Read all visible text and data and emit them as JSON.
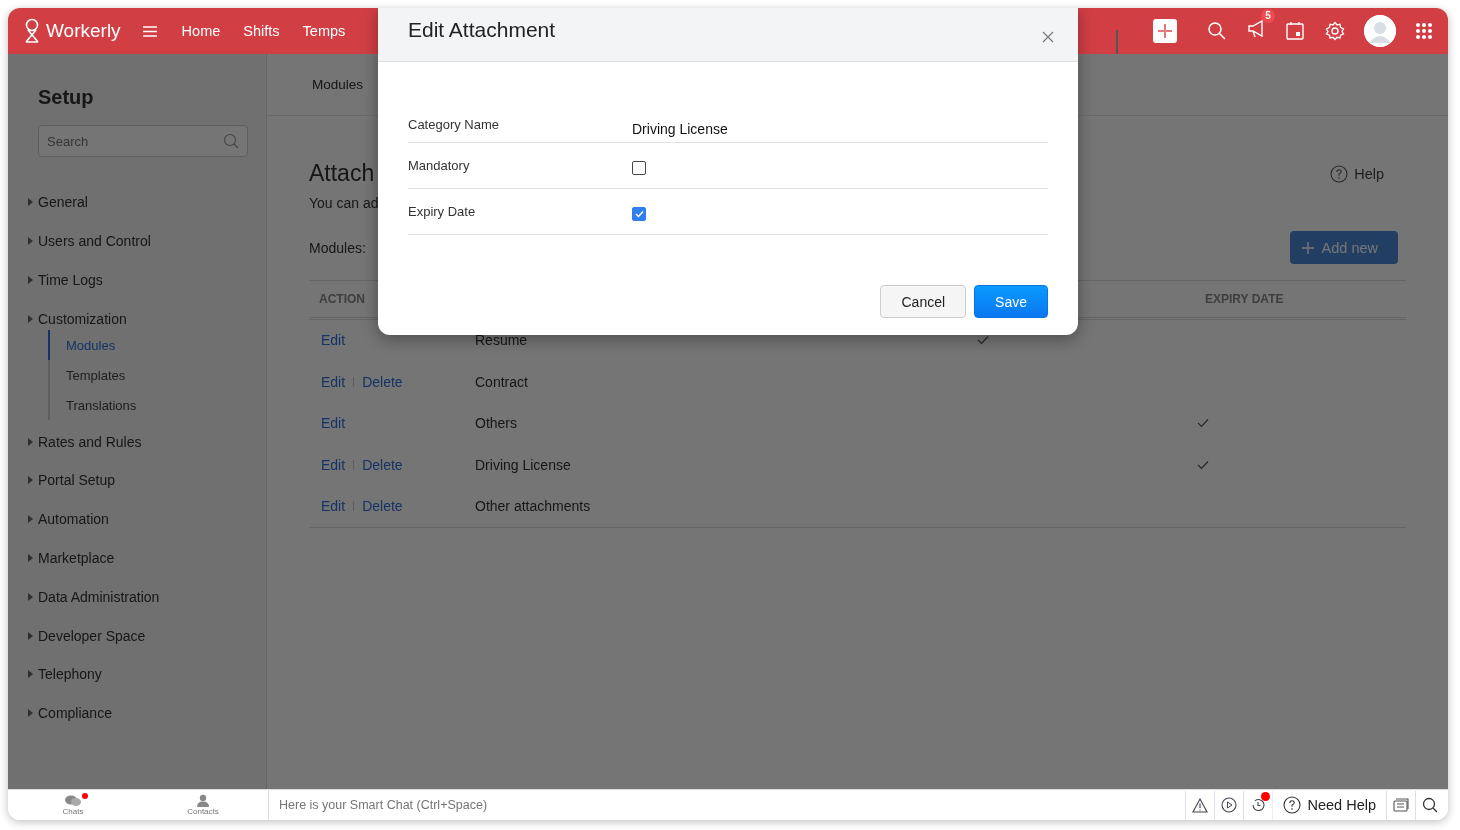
{
  "header": {
    "brand": "Workerly",
    "nav": [
      {
        "label": "Home"
      },
      {
        "label": "Shifts"
      },
      {
        "label": "Temps"
      }
    ],
    "notification_count": "5"
  },
  "sidebar": {
    "title": "Setup",
    "search": {
      "placeholder": "Search"
    },
    "items": [
      {
        "label": "General",
        "selected": false
      },
      {
        "label": "Users and Control",
        "selected": false
      },
      {
        "label": "Time Logs",
        "selected": false
      },
      {
        "label": "Customization",
        "selected": false,
        "children": [
          {
            "label": "Modules",
            "selected": true
          },
          {
            "label": "Templates",
            "selected": false
          },
          {
            "label": "Translations",
            "selected": false
          }
        ]
      },
      {
        "label": "Rates and Rules",
        "selected": false
      },
      {
        "label": "Portal Setup",
        "selected": false
      },
      {
        "label": "Automation",
        "selected": false
      },
      {
        "label": "Marketplace",
        "selected": false
      },
      {
        "label": "Data Administration",
        "selected": false
      },
      {
        "label": "Developer Space",
        "selected": false
      },
      {
        "label": "Telephony",
        "selected": false
      },
      {
        "label": "Compliance",
        "selected": false
      }
    ]
  },
  "main": {
    "breadcrumb": "Modules",
    "title": "Attach",
    "description": "You can ad",
    "modules_label": "Modules:",
    "help": "Help",
    "add_button": "Add new",
    "table": {
      "columns": [
        "ACTION",
        "EXPIRY DATE"
      ],
      "rows": [
        {
          "actions": [
            "Edit"
          ],
          "name": "Resume",
          "column_3_checked": true,
          "expiry_checked": false
        },
        {
          "actions": [
            "Edit",
            "Delete"
          ],
          "name": "Contract",
          "column_3_checked": false,
          "expiry_checked": false
        },
        {
          "actions": [
            "Edit"
          ],
          "name": "Others",
          "column_3_checked": false,
          "expiry_checked": true
        },
        {
          "actions": [
            "Edit",
            "Delete"
          ],
          "name": "Driving License",
          "column_3_checked": false,
          "expiry_checked": true
        },
        {
          "actions": [
            "Edit",
            "Delete"
          ],
          "name": "Other attachments",
          "column_3_checked": false,
          "expiry_checked": false
        }
      ]
    }
  },
  "dialog": {
    "title": "Edit Attachment",
    "fields": [
      {
        "kind": "text",
        "label": "Category Name",
        "value": "Driving License"
      },
      {
        "kind": "checkbox",
        "label": "Mandatory",
        "checked": false
      },
      {
        "kind": "checkbox",
        "label": "Expiry Date",
        "checked": true
      }
    ],
    "buttons": [
      {
        "label": "Cancel",
        "kind": "secondary"
      },
      {
        "label": "Save",
        "kind": "primary"
      }
    ]
  },
  "footer": {
    "tabs": [
      {
        "label": "Chats",
        "kind": "chats",
        "unread": true
      },
      {
        "label": "Contacts",
        "kind": "contacts",
        "unread": false
      }
    ],
    "chat_placeholder": "Here is your Smart Chat (Ctrl+Space)",
    "help": "Need Help"
  }
}
